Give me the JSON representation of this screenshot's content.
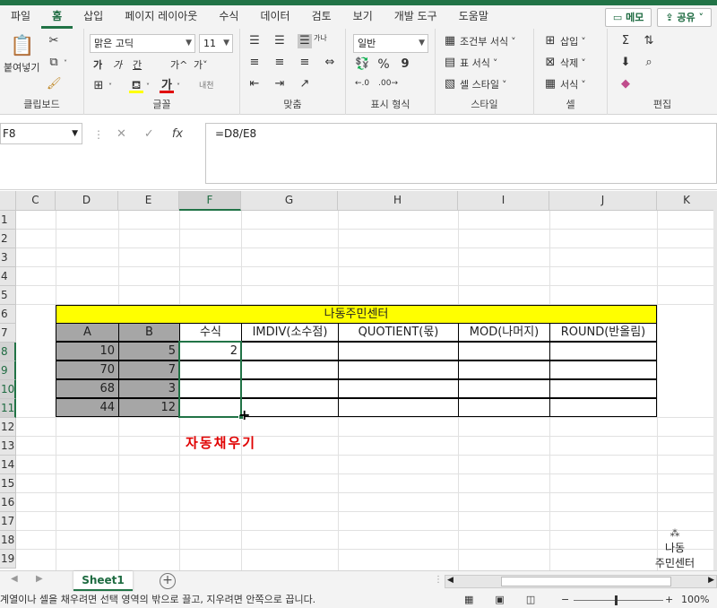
{
  "ribbon_tabs": [
    "파일",
    "홈",
    "삽입",
    "페이지 레이아웃",
    "수식",
    "데이터",
    "검토",
    "보기",
    "개발 도구",
    "도움말"
  ],
  "active_tab": "홈",
  "memo_label": "메모",
  "share_label": "공유",
  "clipboard": {
    "paste": "붙여넣기",
    "label": "클립보드"
  },
  "font": {
    "name": "맑은 고딕",
    "size": "11",
    "label": "글꼴",
    "bold": "가",
    "italic": "가",
    "underline": "간",
    "grow": "가^",
    "shrink": "가˅",
    "color_glyph": "가",
    "phonetic": "내천"
  },
  "alignment": {
    "label": "맞춤",
    "wrap": "가나"
  },
  "number": {
    "format": "일반",
    "percent": "%",
    "comma": "9",
    "label": "표시 형식"
  },
  "styles": {
    "conditional": "조건부 서식",
    "table": "표 서식",
    "cell": "셀 스타일",
    "label": "스타일"
  },
  "cells": {
    "insert": "삽입",
    "delete": "삭제",
    "format": "서식",
    "label": "셀"
  },
  "editing": {
    "label": "편집"
  },
  "name_box": "F8",
  "formula": "=D8/E8",
  "columns": [
    "C",
    "D",
    "E",
    "F",
    "G",
    "H",
    "I",
    "J",
    "K"
  ],
  "rows": [
    "1",
    "2",
    "3",
    "4",
    "5",
    "6",
    "7",
    "8",
    "9",
    "10",
    "11",
    "12",
    "13",
    "14",
    "15",
    "16",
    "17",
    "18",
    "19"
  ],
  "table": {
    "title": "나동주민센터",
    "headers": [
      "A",
      "B",
      "수식",
      "IMDIV(소수점)",
      "QUOTIENT(몫)",
      "MOD(나머지)",
      "ROUND(반올림)"
    ],
    "rows": [
      {
        "a": "10",
        "b": "5",
        "f": "2"
      },
      {
        "a": "70",
        "b": "7",
        "f": ""
      },
      {
        "a": "68",
        "b": "3",
        "f": ""
      },
      {
        "a": "44",
        "b": "12",
        "f": ""
      }
    ]
  },
  "annotation": "자동채우기",
  "logo": {
    "line1": "나동",
    "line2": "주민센터"
  },
  "sheet_tab": "Sheet1",
  "status_message": "계열이나 셀을 채우려면 선택 영역의 밖으로 끌고, 지우려면 안쪽으로 끕니다.",
  "zoom": "100%"
}
